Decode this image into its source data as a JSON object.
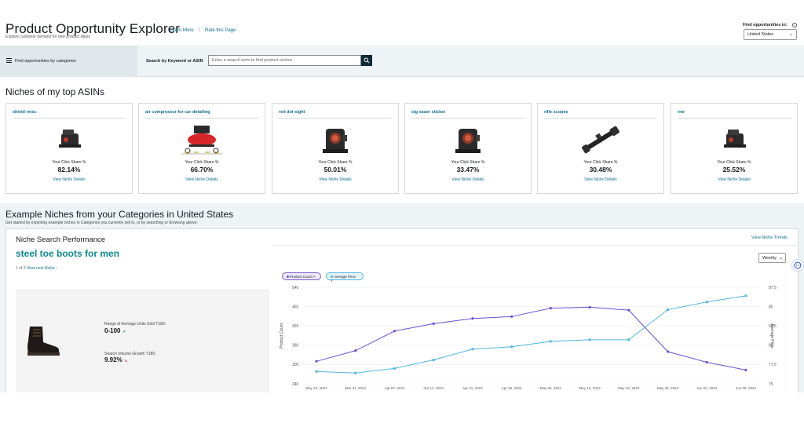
{
  "header": {
    "title": "Product Opportunity Explorer",
    "subtitle": "Explore customer demand for new product ideas",
    "learn_more": "Learn More",
    "separator": "|",
    "rate_page": "Rate this Page",
    "find_label": "Find opportunities in:",
    "info_icon": "i",
    "country": "United States",
    "chevron": "⌄"
  },
  "filter_bar": {
    "category_toggle": "Find opportunities by categories",
    "keyword_label": "Search by Keyword or ASIN",
    "keyword_placeholder": "Enter a search term to find product niches"
  },
  "top_asins": {
    "title": "Niches of my top ASINs",
    "share_label": "Your Click Share %",
    "link_label": "View Niche Details",
    "cards": [
      {
        "name": "shield rmsc",
        "share": "82.14%",
        "image": "red-dot-sight-small"
      },
      {
        "name": "air compressor for car detailing",
        "share": "66.70%",
        "image": "air-compressor"
      },
      {
        "name": "red dot sight",
        "share": "50.01%",
        "image": "red-dot-sight"
      },
      {
        "name": "sig sauer sticker",
        "share": "33.47%",
        "image": "red-dot-sight"
      },
      {
        "name": "rifle scopes",
        "share": "30.48%",
        "image": "rifle-scope"
      },
      {
        "name": "rmr",
        "share": "25.52%",
        "image": "red-dot-sight-small"
      }
    ]
  },
  "examples": {
    "title": "Example Niches from your Categories in United States",
    "subtitle": "Get started by exploring example niches in Categories you currently sell in, or by searching or browsing above.",
    "panel_title": "Niche Search Performance",
    "niche_name": "steel toe boots for men",
    "pager_count": "1 of 3",
    "pager_next": "View next Niche ›",
    "view_trends": "View Niche Trends",
    "period": "Weekly",
    "stats": [
      {
        "label": "Range of Average Units Sold T180:",
        "value": "0-100",
        "trend": "up"
      },
      {
        "label": "Search Volume Growth T180:",
        "value": "9.92%",
        "trend": "down"
      }
    ],
    "trend_up_glyph": "↗",
    "trend_down_glyph": "↘"
  },
  "colors": {
    "product_count": "#6b4fd1",
    "average_price": "#4fb4e0",
    "link": "#0e6b8a",
    "accent": "#0e8a8f"
  },
  "chart_data": {
    "type": "line",
    "x": [
      "May 24, 2024",
      "Mar 31, 2024",
      "Apr 07, 2024",
      "Apr 14, 2024",
      "Apr 21, 2024",
      "Apr 28, 2024",
      "May 05, 2024",
      "May 12, 2024",
      "May 19, 2024",
      "May 26, 2024",
      "Jun 02, 2024",
      "Jun 09, 2024"
    ],
    "series": [
      {
        "name": "Product Count",
        "axis": "left",
        "values": [
          310,
          343,
          404,
          427,
          443,
          449,
          475,
          478,
          469,
          340,
          307,
          283
        ]
      },
      {
        "name": "Average Price",
        "axis": "right",
        "values": [
          76.6,
          76.4,
          77.0,
          78.1,
          79.5,
          79.8,
          80.5,
          80.7,
          80.7,
          84.6,
          85.6,
          86.4
        ]
      }
    ],
    "ylabel": "Product Count",
    "y2label": "Average Price",
    "ylim": [
      240,
      540
    ],
    "y2lim": [
      75,
      87.5
    ],
    "yticks": [
      "540",
      "460",
      "420",
      "360",
      "300",
      "240"
    ],
    "yticks_values": [
      540,
      480,
      420,
      360,
      300,
      240
    ],
    "y2ticks": [
      "87.5",
      "85",
      "82.5",
      "80",
      "77.5",
      "75"
    ],
    "y2ticks_values": [
      87.5,
      85,
      82.5,
      80,
      77.5,
      75
    ],
    "legend": [
      "Product Count",
      "Average Price"
    ],
    "grid": true
  }
}
